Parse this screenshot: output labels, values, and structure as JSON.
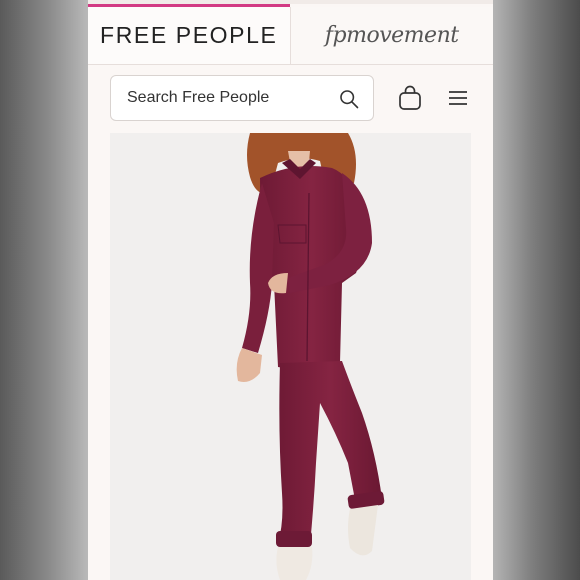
{
  "header": {
    "tabs": [
      {
        "label": "FREE PEOPLE",
        "active": true
      },
      {
        "label": "fpmovement",
        "active": false
      }
    ]
  },
  "search": {
    "placeholder": "Search Free People",
    "value": ""
  },
  "icons": {
    "search": "search-icon",
    "bag": "shopping-bag-icon",
    "menu": "hamburger-menu-icon"
  },
  "product": {
    "image": "model-wearing-burgundy-jumpsuit"
  },
  "colors": {
    "accent": "#d23a83",
    "jumpsuit": "#7a1f3c",
    "background": "#fbf7f5"
  }
}
